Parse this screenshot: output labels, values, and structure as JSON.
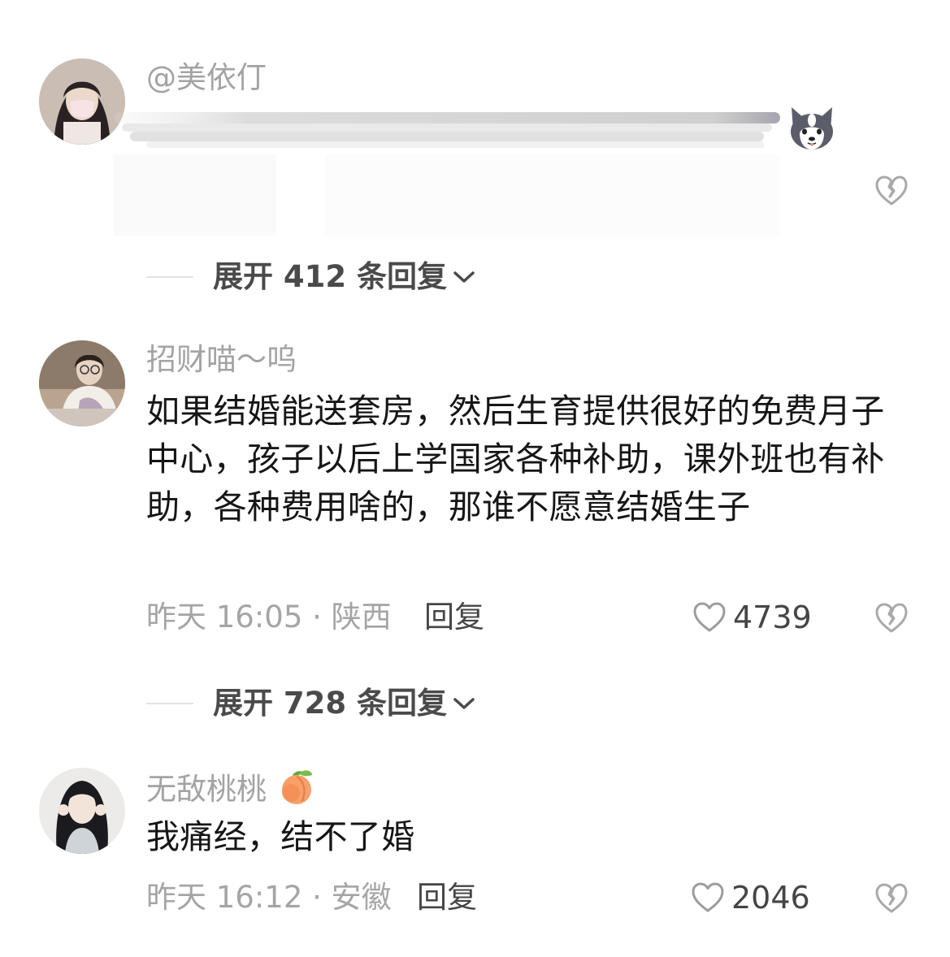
{
  "comments": [
    {
      "username": "@美依仃",
      "content": "",
      "avatar_icon": "avatar-woman-mask",
      "trailing_emoji": "husky-dog-emoji"
    },
    {
      "username": "招财喵～呜",
      "content": "如果结婚能送套房，然后生育提供很好的免费月子中心，孩子以后上学国家各种补助，课外班也有补助，各种费用啥的，那谁不愿意结婚生子",
      "timestamp": "昨天 16:05 · 陕西",
      "reply_label": "回复",
      "likes": "4739",
      "avatar_icon": "avatar-girl-sitting"
    },
    {
      "username": "无敌桃桃",
      "username_emoji": "peach-emoji",
      "content": "我痛经，结不了婚",
      "timestamp": "昨天 16:12 · 安徽",
      "reply_label": "回复",
      "likes": "2046",
      "avatar_icon": "avatar-girl-heart-hands"
    }
  ],
  "expand_replies": [
    {
      "label": "展开 412 条回复"
    },
    {
      "label": "展开 728 条回复"
    }
  ],
  "colors": {
    "username": "#a3a3a3",
    "content": "#161616",
    "meta": "#a5a5a5",
    "action": "#454545"
  }
}
